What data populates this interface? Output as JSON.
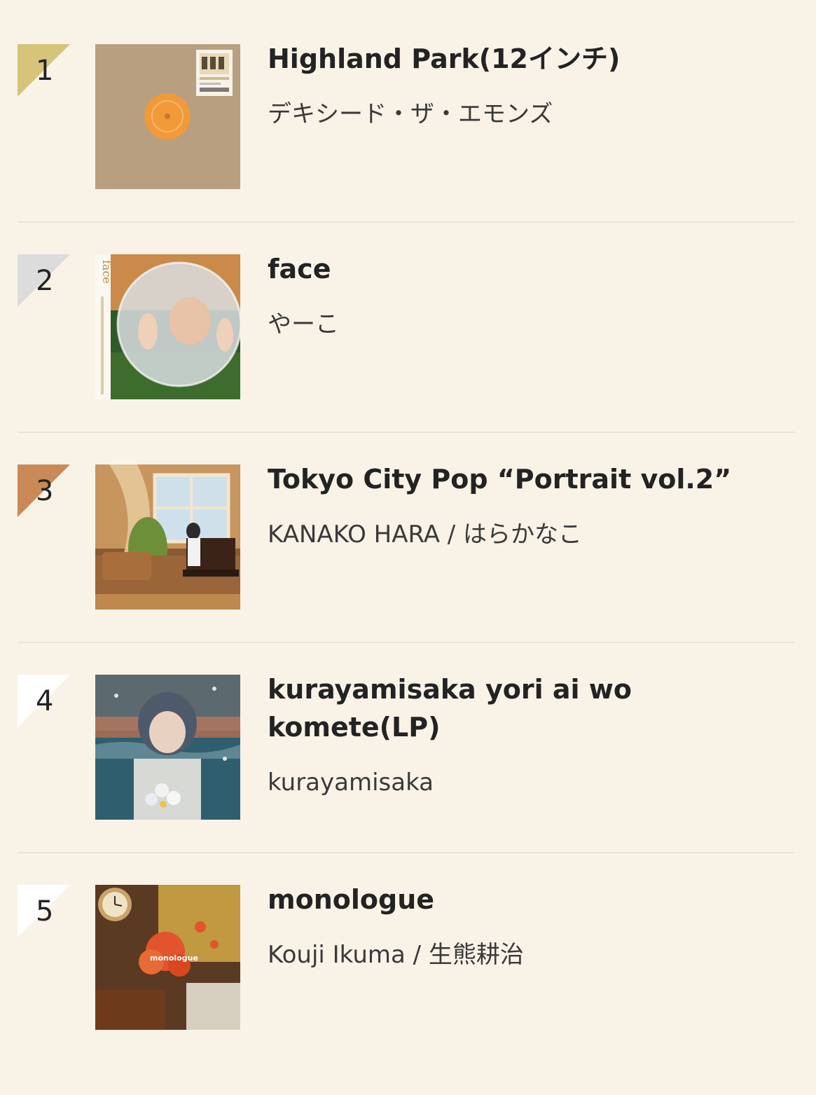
{
  "colors": {
    "background": "#f9f3e7",
    "divider": "#ece4d3",
    "gold": "#d6c47a",
    "silver": "#dcdcdc",
    "bronze": "#c98a57",
    "plain": "#ffffff"
  },
  "ranking": [
    {
      "rank": "1",
      "title": "Highland Park(12インチ)",
      "artist": "デキシード・ザ・エモンズ",
      "badge": "gold"
    },
    {
      "rank": "2",
      "title": "face",
      "artist": "やーこ",
      "badge": "silver"
    },
    {
      "rank": "3",
      "title": "Tokyo City Pop “Portrait vol.2”",
      "artist": "KANAKO HARA / はらかなこ",
      "badge": "bronze"
    },
    {
      "rank": "4",
      "title": "kurayamisaka yori ai wo komete(LP)",
      "artist": "kurayamisaka",
      "badge": "plain"
    },
    {
      "rank": "5",
      "title": "monologue",
      "artist": "Kouji Ikuma / 生熊耕治",
      "badge": "plain"
    }
  ],
  "covers": {
    "face_spine_text": "face",
    "monologue_text": "monologue"
  }
}
